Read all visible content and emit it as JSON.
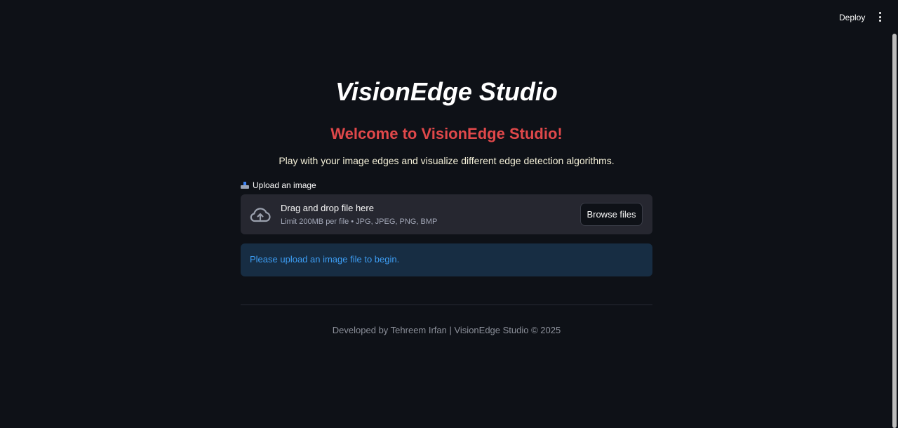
{
  "header": {
    "deploy_label": "Deploy",
    "menu_icon": "more-vertical-icon"
  },
  "main": {
    "title": "VisionEdge Studio",
    "welcome": "Welcome to VisionEdge Studio!",
    "subtitle": "Play with your image edges and visualize different edge detection algorithms.",
    "upload": {
      "icon": "inbox-tray-icon",
      "label": "Upload an image",
      "dropzone": {
        "icon": "cloud-upload-icon",
        "title": "Drag and drop file here",
        "limit": "Limit 200MB per file • JPG, JPEG, PNG, BMP",
        "browse_label": "Browse files"
      }
    },
    "info_message": "Please upload an image file to begin.",
    "footer": "Developed by Tehreem Irfan | VisionEdge Studio © 2025"
  },
  "colors": {
    "background": "#0e1117",
    "welcome_red": "#e0484a",
    "info_bg": "#172d43",
    "info_text": "#3d9df3",
    "dropzone_bg": "#262730"
  }
}
